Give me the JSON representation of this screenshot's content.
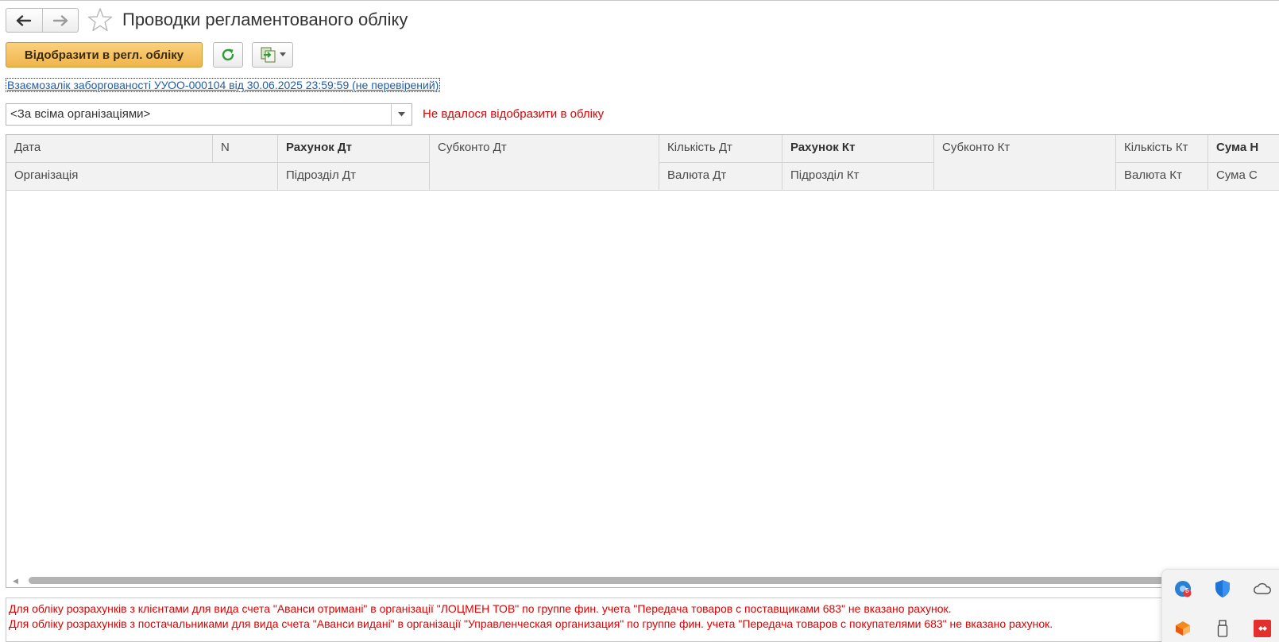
{
  "window": {
    "title": "Проводки регламентованого обліку"
  },
  "toolbar": {
    "post_label": "Відобразити в регл. обліку"
  },
  "document": {
    "link_text": "Взаємозалік заборгованості УУОО-000104 від 30.06.2025 23:59:59 (не перевірений)"
  },
  "filter": {
    "organization_value": "<За всіма організаціями>"
  },
  "status": {
    "warning": "Не вдалося відобразити в обліку"
  },
  "grid": {
    "headers": {
      "date": "Дата",
      "n": "N",
      "account_dt": "Рахунок Дт",
      "subconto_dt": "Субконто Дт",
      "qty_dt": "Кількість Дт",
      "account_kt": "Рахунок Кт",
      "subconto_kt": "Субконто Кт",
      "qty_kt": "Кількість Кт",
      "sum": "Сума Н",
      "organization": "Організація",
      "dept_dt": "Підрозділ Дт",
      "currency_dt": "Валюта Дт",
      "dept_kt": "Підрозділ Кт",
      "currency_kt": "Валюта Кт",
      "sum_currency": "Сума С"
    },
    "rows": []
  },
  "messages": [
    "Для обліку розрахунків з клієнтами для вида счета \"Аванси отримані\" в організації \"ЛОЦМЕН ТОВ\" по группе фин. учета \"Передача товаров с поставщиками 683\" не вказано рахунок.",
    "Для обліку розрахунків з постачальниками для вида счета \"Аванси видані\" в організації \"Управленческая организация\" по группе фин. учета \"Передача товаров с покупателями 683\" не вказано рахунок."
  ],
  "tray_popup": {
    "icons": [
      "browser-icon",
      "defender-shield-icon",
      "onedrive-cloud-icon",
      "office-app-icon",
      "usb-drive-icon",
      "anydesk-icon"
    ],
    "browser_badge": "5"
  },
  "colors": {
    "primary_button": "#f5bd55",
    "link": "#1f5ea8",
    "error": "#e10000",
    "grid_header_bg": "#f2f2f2"
  }
}
